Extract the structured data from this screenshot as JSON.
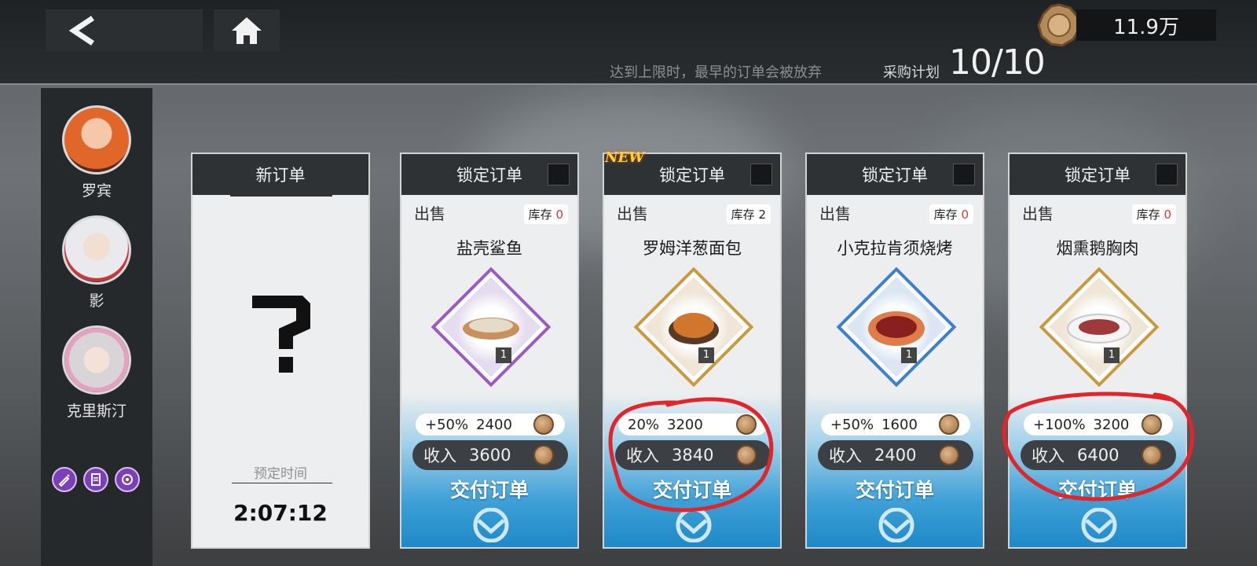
{
  "topbar": {
    "coins": "11.9万",
    "hint": "达到上限时，最早的订单会被放弃",
    "plan_label": "采购计划",
    "plan_value": "10/10"
  },
  "characters": [
    {
      "name": "罗宾"
    },
    {
      "name": "影"
    },
    {
      "name": "克里斯汀"
    }
  ],
  "new_order": {
    "title": "新订单",
    "scheduled_label": "预定时间",
    "scheduled_time": "2:07:12"
  },
  "orders": [
    {
      "header": "锁定订单",
      "sell": "出售",
      "stock_label": "库存",
      "stock": "0",
      "food": "盐壳鲨鱼",
      "qty": "1",
      "bonus": "+50%",
      "bonus_value": "2400",
      "income_label": "收入",
      "income": "3600",
      "deliver": "交付订单",
      "frame_color": "#9b59c6"
    },
    {
      "header": "锁定订单",
      "sell": "出售",
      "stock_label": "库存",
      "stock": "2",
      "food": "罗姆洋葱面包",
      "qty": "1",
      "bonus": "20%",
      "bonus_value": "3200",
      "income_label": "收入",
      "income": "3840",
      "deliver": "交付订单",
      "frame_color": "#c89a3c",
      "new": "NEW"
    },
    {
      "header": "锁定订单",
      "sell": "出售",
      "stock_label": "库存",
      "stock": "0",
      "food": "小克拉肯须烧烤",
      "qty": "1",
      "bonus": "+50%",
      "bonus_value": "1600",
      "income_label": "收入",
      "income": "2400",
      "deliver": "交付订单",
      "frame_color": "#3a7fd0"
    },
    {
      "header": "锁定订单",
      "sell": "出售",
      "stock_label": "库存",
      "stock": "0",
      "food": "烟熏鹅胸肉",
      "qty": "1",
      "bonus": "+100%",
      "bonus_value": "3200",
      "income_label": "收入",
      "income": "6400",
      "deliver": "交付订单",
      "frame_color": "#c89a3c"
    }
  ]
}
